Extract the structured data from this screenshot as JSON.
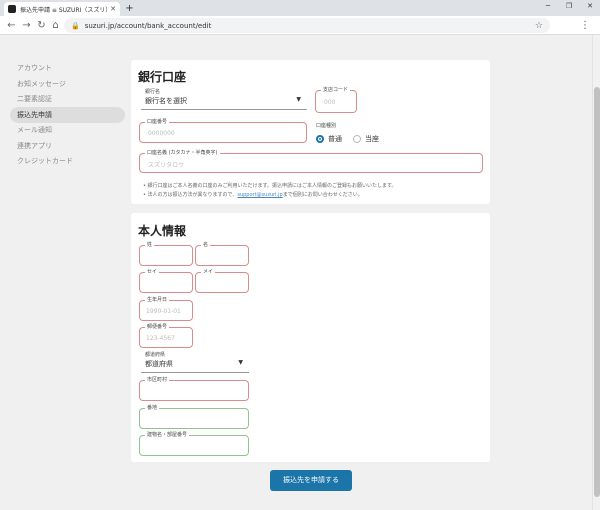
{
  "browser": {
    "tab_title": "振込先申請 ≡ SUZURI（スズリ）",
    "url": "suzuri.jp/account/bank_account/edit"
  },
  "sidebar": {
    "items": [
      {
        "label": "アカウント"
      },
      {
        "label": "お知メッセージ"
      },
      {
        "label": "二要素認証"
      },
      {
        "label": "振込先申請"
      },
      {
        "label": "メール通知"
      },
      {
        "label": "連携アプリ"
      },
      {
        "label": "クレジットカード"
      }
    ]
  },
  "bank": {
    "title": "銀行口座",
    "bank_name": {
      "label": "銀行名",
      "value": "銀行名を選択"
    },
    "branch_code": {
      "label": "支店コード",
      "placeholder": "000"
    },
    "account_number": {
      "label": "口座番号",
      "placeholder": "0000000"
    },
    "account_type": {
      "label": "口座種別",
      "options": [
        "普通",
        "当座"
      ],
      "selected": "普通"
    },
    "account_holder": {
      "label": "口座名義 (カタカナ・半角英字)",
      "placeholder": "スズリタロウ"
    },
    "notes": [
      "銀行口座はご本人名義の口座のみご利用いただけます。振込申請にはご本人情報のご登録もお願いいたします。",
      "法人の方は振込方法が異なりますので、support@suzuri.jp まで個別にお問い合わせください。"
    ],
    "note2_prefix": "法人の方は振込方法が異なりますので、",
    "note2_link": "support@suzuri.jp",
    "note2_suffix": "まで個別にお問い合わせください。"
  },
  "personal": {
    "title": "本人情報",
    "last_name": {
      "label": "姓"
    },
    "first_name": {
      "label": "名"
    },
    "last_name_kana": {
      "label": "セイ"
    },
    "first_name_kana": {
      "label": "メイ"
    },
    "birthday": {
      "label": "生年月日",
      "placeholder": "1990-01-01"
    },
    "postal_code": {
      "label": "郵便番号",
      "placeholder": "123-4567"
    },
    "prefecture": {
      "label": "都道府県",
      "value": "都道府県"
    },
    "city": {
      "label": "市区町村"
    },
    "street": {
      "label": "番地"
    },
    "building": {
      "label": "建物名・部屋番号"
    }
  },
  "submit_label": "振込先を申請する",
  "colors": {
    "primary": "#1b75a8",
    "error_border": "#d98c8c",
    "valid_border": "#8ec48e"
  }
}
